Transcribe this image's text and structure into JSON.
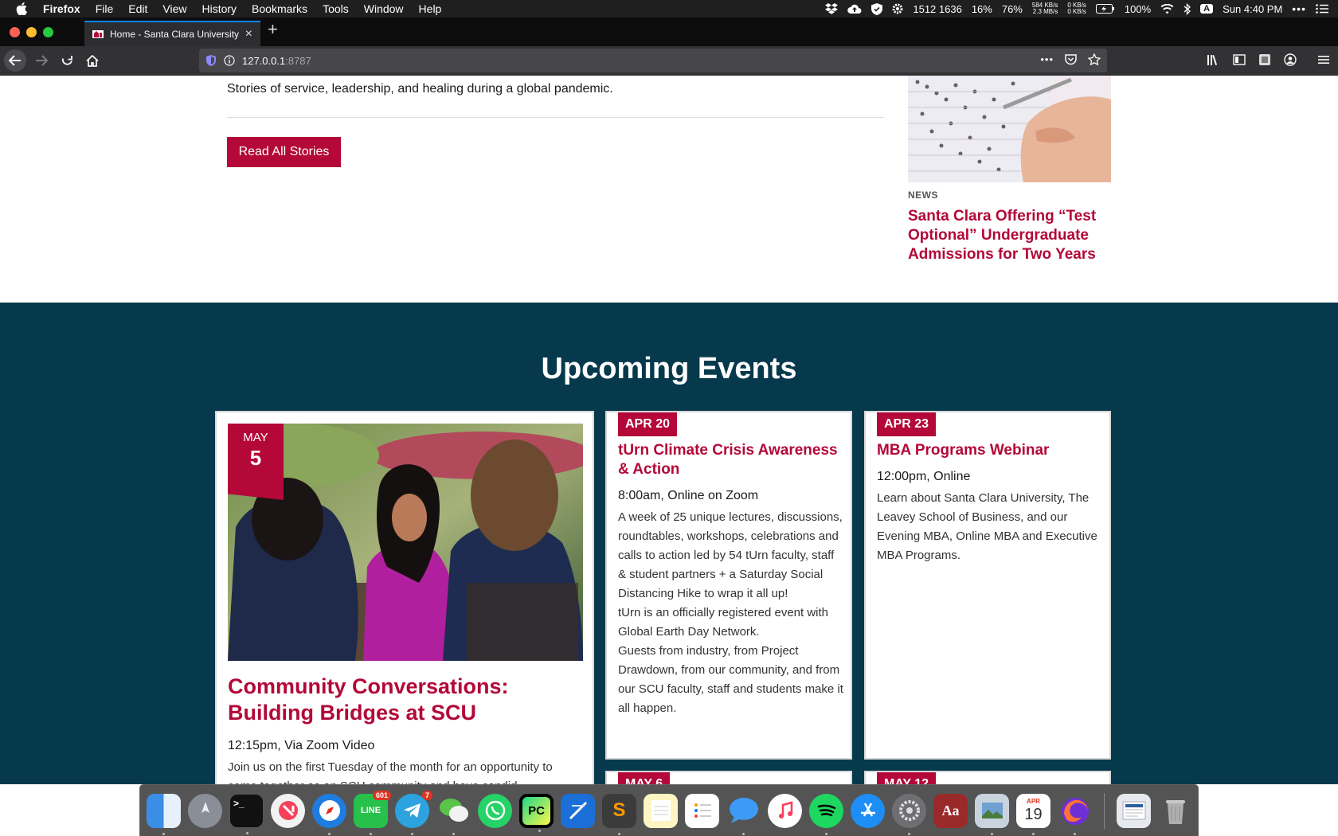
{
  "menubar": {
    "app_name": "Firefox",
    "items": [
      "File",
      "Edit",
      "View",
      "History",
      "Bookmarks",
      "Tools",
      "Window",
      "Help"
    ],
    "status": {
      "istat_numbers": "1512 1636",
      "cpu": "16%",
      "memory": "76%",
      "net_up": "584 KB/s",
      "net_down": "2.3 MB/s",
      "disk_r": "0 KB/s",
      "disk_w": "0 KB/s",
      "battery": "100%",
      "input_source": "A",
      "clock": "Sun 4:40 PM"
    }
  },
  "browser": {
    "tab_title": "Home - Santa Clara University",
    "url_host": "127.0.0.1",
    "url_port": ":8787"
  },
  "page": {
    "stories_description": "Stories of service, leadership, and healing during a global pandemic.",
    "read_all_label": "Read All Stories",
    "news": {
      "tag": "NEWS",
      "title": "Santa Clara Offering “Test Optional” Undergraduate Admissions for Two Years"
    },
    "events_heading": "Upcoming Events",
    "featured_event": {
      "month": "MAY",
      "day": "5",
      "title": "Community Conversations: Building Bridges at SCU",
      "time": "12:15pm, Via Zoom Video",
      "description": "Join us on the first Tuesday of the month for an opportunity to come together as an SCU community and have candid"
    },
    "events": [
      {
        "date": "APR 20",
        "title": "tUrn Climate Crisis Awareness & Action",
        "time": "8:00am, Online on Zoom",
        "paragraphs": [
          "A week of 25 unique lectures, discussions, roundtables, workshops, celebrations and calls to action led by 54 tUrn faculty, staff & student partners + a Saturday Social Distancing Hike to wrap it all up!",
          "tUrn is an officially registered event with Global Earth Day Network.",
          "Guests from industry, from Project Drawdown, from our community, and from our SCU faculty, staff and students make it all happen."
        ]
      },
      {
        "date": "APR 23",
        "title": "MBA Programs Webinar",
        "time": "12:00pm, Online",
        "paragraphs": [
          "Learn about Santa Clara University, The Leavey School of Business, and our Evening MBA, Online MBA and Executive MBA Programs."
        ]
      },
      {
        "date": "MAY 6"
      },
      {
        "date": "MAY 12"
      }
    ]
  },
  "dock": {
    "apps": [
      "finder-icon",
      "launchpad-icon",
      "terminal-icon",
      "news-icon",
      "safari-icon",
      "line-icon",
      "telegram-icon",
      "wechat-icon",
      "whatsapp-icon",
      "pycharm-icon",
      "xcode-icon",
      "sublime-icon",
      "notes-icon",
      "reminders-icon",
      "messages-icon",
      "music-icon",
      "spotify-icon",
      "app-store-icon",
      "system-preferences-icon",
      "dictionary-icon",
      "preview-icon",
      "calendar-icon",
      "firefox-icon"
    ],
    "line_badge": "601",
    "telegram_badge": "7",
    "terminal_text": ">_",
    "pycharm_text": "PC",
    "dictionary_text": "Aa",
    "calendar_month": "APR",
    "calendar_day": "19"
  }
}
